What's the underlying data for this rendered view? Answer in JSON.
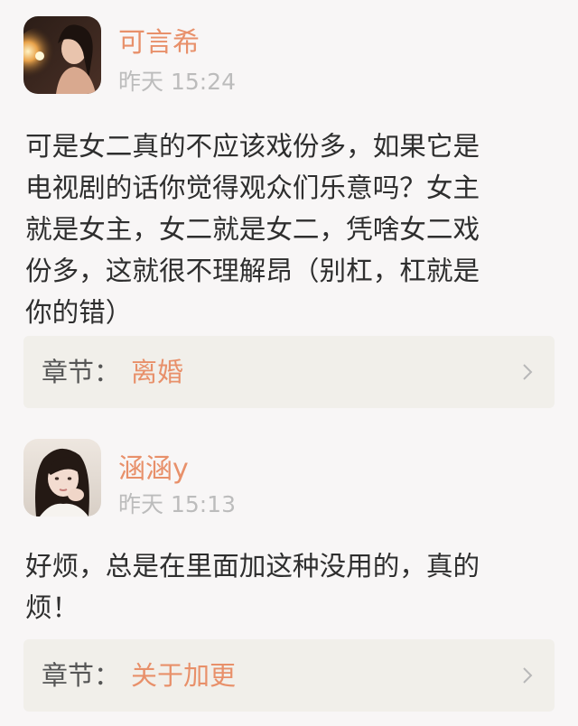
{
  "comments": [
    {
      "username": "可言希",
      "time": "昨天 15:24",
      "lines": [
        "可是女二真的不应该戏份多，如果它是",
        "电视剧的话你觉得观众们乐意吗？女主",
        "就是女主，女二就是女二，凭啥女二戏",
        "份多，这就很不理解昂（别杠，杠就是",
        "你的错）"
      ],
      "chapter_label": "章节：",
      "chapter_name": "离婚",
      "avatar_icon": "user-avatar-candle-portrait"
    },
    {
      "username": "涵涵y",
      "time": "昨天 15:13",
      "lines": [
        "好烦，总是在里面加这种没用的，真的",
        "烦！"
      ],
      "chapter_label": "章节：",
      "chapter_name": "关于加更",
      "avatar_icon": "user-avatar-girl-portrait"
    }
  ],
  "colors": {
    "accent": "#e8906a",
    "timestamp": "#bcbcbc",
    "text": "#2e2e2e",
    "background": "#f8f6f6",
    "chapter_bar": "#f1efea"
  }
}
